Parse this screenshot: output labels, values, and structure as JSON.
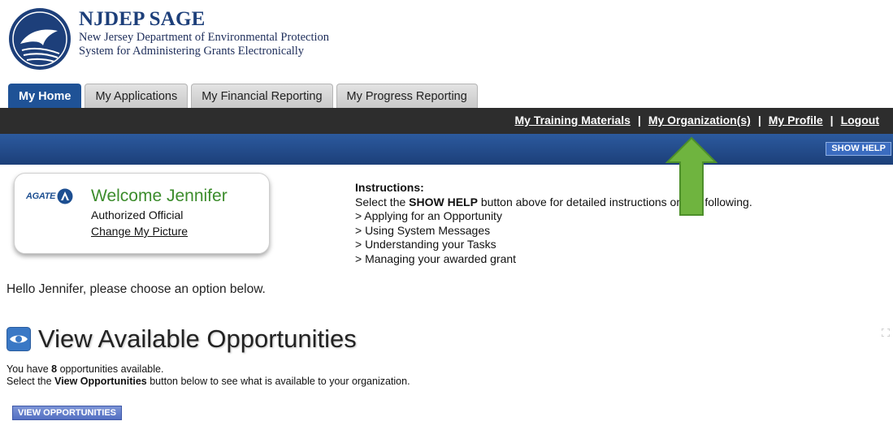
{
  "brand": {
    "title": "NJDEP SAGE",
    "line1": "New Jersey Department of Environmental Protection",
    "line2": "System for Administering Grants Electronically"
  },
  "tabs": [
    {
      "label": "My Home",
      "active": true
    },
    {
      "label": "My Applications",
      "active": false
    },
    {
      "label": "My Financial Reporting",
      "active": false
    },
    {
      "label": "My Progress Reporting",
      "active": false
    }
  ],
  "nav": {
    "training": "My Training Materials",
    "organizations": "My Organization(s)",
    "profile": "My Profile",
    "logout": "Logout",
    "separator": "|"
  },
  "help_button": "SHOW HELP",
  "welcome": {
    "brand_text": "AGATE",
    "title": "Welcome Jennifer",
    "role": "Authorized Official",
    "change_picture": "Change My Picture"
  },
  "instructions": {
    "title": "Instructions:",
    "line_prefix": "Select the ",
    "line_bold": "SHOW HELP",
    "line_suffix": " button above for detailed instructions on the following.",
    "items": [
      "> Applying for an Opportunity",
      "> Using System Messages",
      "> Understanding your Tasks",
      "> Managing your awarded grant"
    ]
  },
  "hello": "Hello Jennifer, please choose an option below.",
  "section": {
    "title": "View Available Opportunities",
    "count_prefix": "You have ",
    "count": "8",
    "count_suffix": " opportunities available.",
    "select_prefix": "Select the ",
    "select_bold": "View Opportunities",
    "select_suffix": " button below to see what is available to your organization.",
    "button": "VIEW OPPORTUNITIES"
  },
  "colors": {
    "brand_blue": "#1d3f7a",
    "tab_active": "#1f5296",
    "navbar": "#2d2d2d",
    "welcome_green": "#3c8c2c",
    "arrow_green": "#6fb43f"
  }
}
